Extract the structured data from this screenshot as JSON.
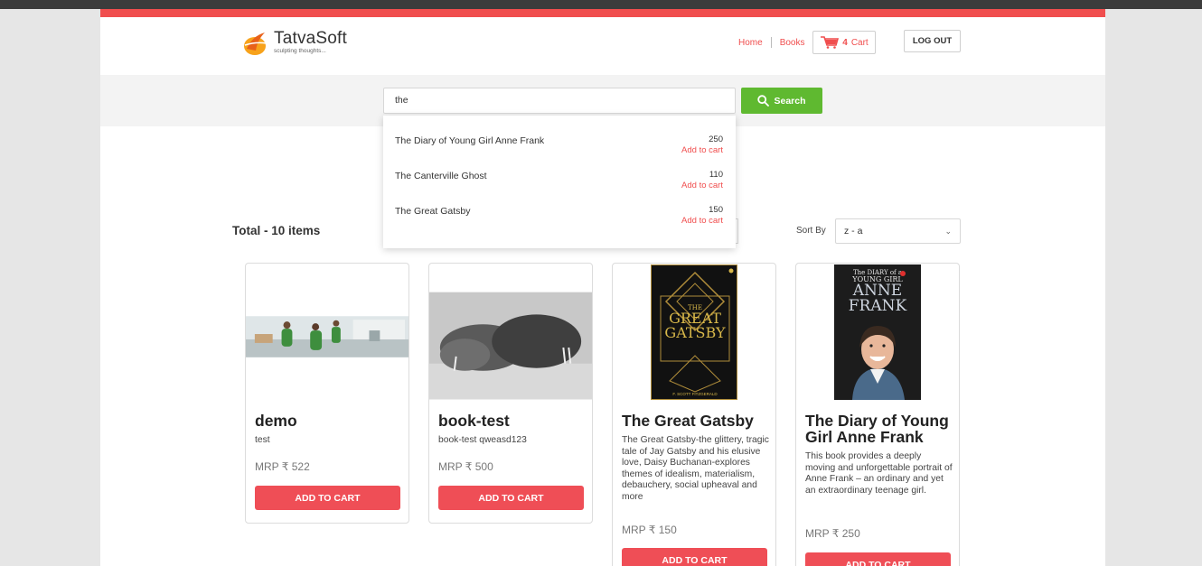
{
  "header": {
    "logo_name": "TatvaSoft",
    "logo_tagline": "sculpting thoughts...",
    "nav": {
      "home": "Home",
      "books": "Books",
      "cart_count": "4",
      "cart_label": "Cart"
    },
    "logout_label": "LOG OUT"
  },
  "search": {
    "value": "the",
    "button_label": "Search",
    "suggestions": [
      {
        "title": "The Diary of Young Girl Anne Frank",
        "price": "250",
        "action": "Add to cart"
      },
      {
        "title": "The Canterville Ghost",
        "price": "110",
        "action": "Add to cart"
      },
      {
        "title": "The Great Gatsby",
        "price": "150",
        "action": "Add to cart"
      }
    ]
  },
  "listing": {
    "total": "Total - 10 items",
    "sort_label": "Sort By",
    "sort_value": "z - a"
  },
  "books": [
    {
      "title": "demo",
      "description": "test",
      "price": "MRP ₹ 522",
      "button": "ADD TO CART"
    },
    {
      "title": "book-test",
      "description": "book-test qweasd123",
      "price": "MRP ₹ 500",
      "button": "ADD TO CART"
    },
    {
      "title": "The Great Gatsby",
      "description": "The Great Gatsby-the glittery, tragic tale of Jay Gatsby and his elusive love, Daisy Buchanan-explores themes of idealism, materialism, debauchery, social upheaval and more",
      "price": "MRP ₹ 150",
      "button": "ADD TO CART",
      "cover_lines": [
        "THE",
        "GREAT",
        "GATSBY"
      ],
      "cover_author": "F. SCOTT FITZGERALD"
    },
    {
      "title": "The Diary of Young Girl Anne Frank",
      "description": "This book provides a deeply moving and unforgettable portrait of Anne Frank – an ordinary and yet an extraordinary teenage girl.",
      "price": "MRP ₹ 250",
      "button": "ADD TO CART",
      "cover_lines": [
        "The DIARY of a",
        "YOUNG GIRL",
        "ANNE",
        "FRANK"
      ]
    }
  ],
  "colors": {
    "accent": "#f04e4e",
    "search_green": "#5fb930",
    "button_red": "#ef4e56"
  }
}
